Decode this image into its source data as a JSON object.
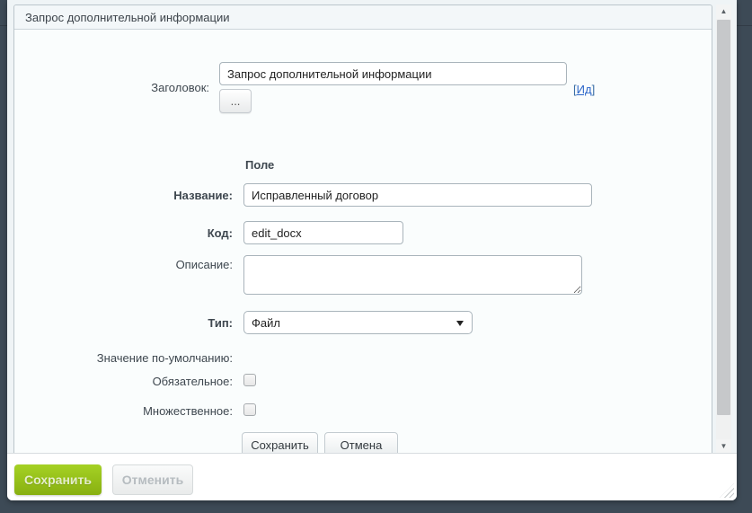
{
  "panel": {
    "title": "Запрос дополнительной информации"
  },
  "form": {
    "header_field": {
      "label": "Заголовок:",
      "value": "Запрос дополнительной информации",
      "more_button": "...",
      "id_link": {
        "open": "[",
        "label": "Ид",
        "close": "]"
      }
    },
    "section_title": "Поле",
    "name_field": {
      "label": "Название:",
      "value": "Исправленный договор"
    },
    "code_field": {
      "label": "Код:",
      "value": "edit_docx"
    },
    "description_field": {
      "label": "Описание:",
      "value": ""
    },
    "type_field": {
      "label": "Тип:",
      "value": "Файл"
    },
    "default_value_field": {
      "label": "Значение по-умолчанию:"
    },
    "required_field": {
      "label": "Обязательное:",
      "checked": false
    },
    "multiple_field": {
      "label": "Множественное:",
      "checked": false
    },
    "save_button": "Сохранить",
    "cancel_button": "Отмена"
  },
  "footer": {
    "save_button": "Сохранить",
    "cancel_button": "Отменить"
  },
  "scrollbar": {
    "up_arrow": "▲",
    "down_arrow": "▼"
  },
  "colors": {
    "background": "#3d4a56",
    "dialog": "#ffffff",
    "viewport": "#eff4f6",
    "accent_green": "#95bf1a",
    "link_blue": "#2b66c9"
  }
}
